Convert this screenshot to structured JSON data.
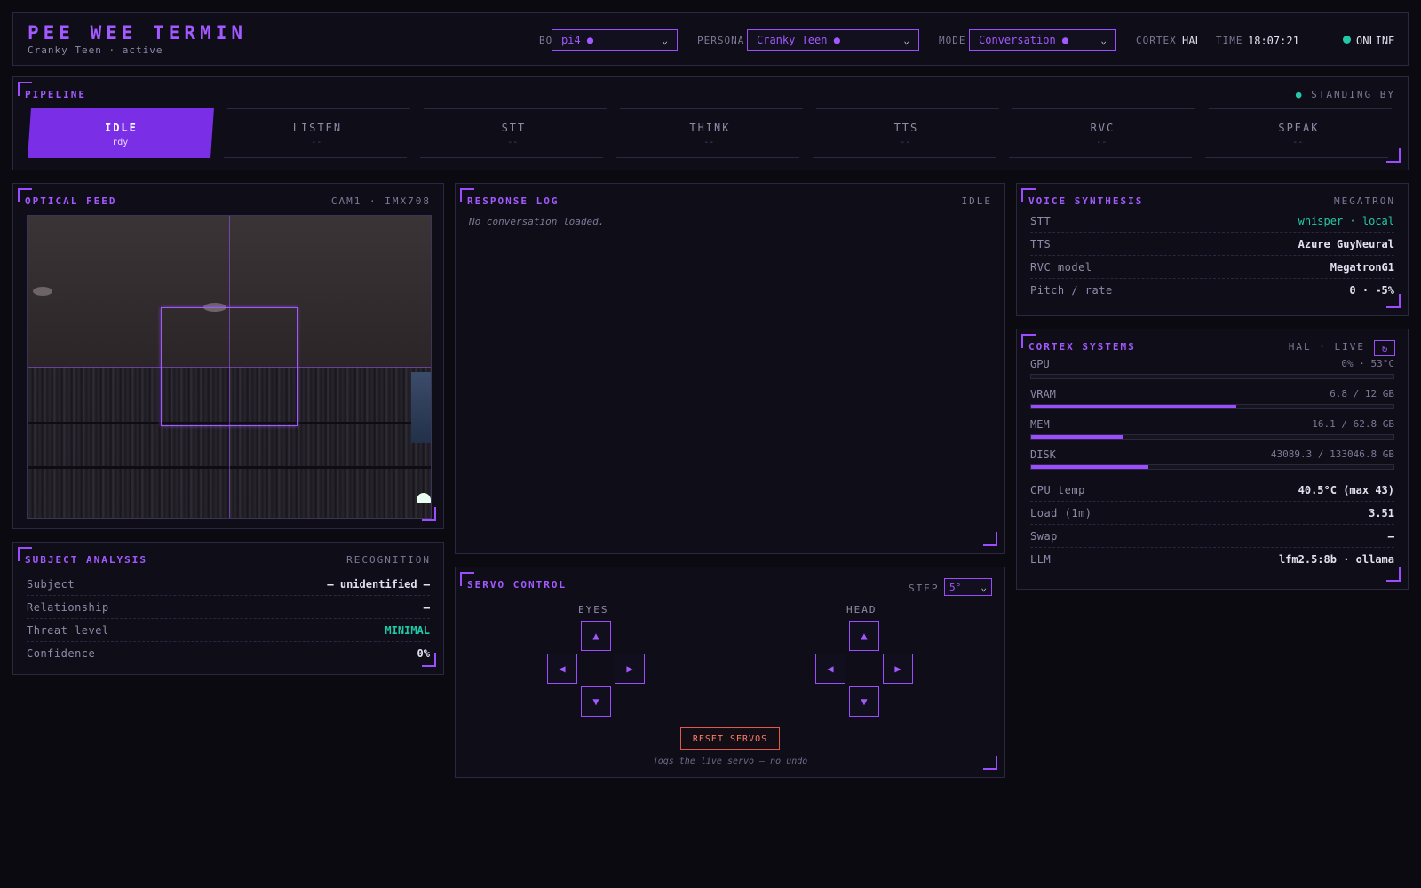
{
  "header": {
    "title": "PEE WEE TERMIN",
    "subtitle": "Cranky Teen · active",
    "bot_label": "BOT",
    "bot_value": "pi4 ●",
    "persona_label": "PERSONA",
    "persona_value": "Cranky Teen ●",
    "mode_label": "MODE",
    "mode_value": "Conversation ●",
    "cortex_label": "CORTEX",
    "cortex_value": "HAL",
    "time_label": "TIME",
    "time_value": "18:07:21",
    "status": "ONLINE",
    "status_color": "#22c8a8"
  },
  "pipeline": {
    "title": "PIPELINE",
    "status": "STANDING BY",
    "stages": [
      {
        "name": "IDLE",
        "value": "rdy",
        "active": true
      },
      {
        "name": "LISTEN",
        "value": "--"
      },
      {
        "name": "STT",
        "value": "--"
      },
      {
        "name": "THINK",
        "value": "--"
      },
      {
        "name": "TTS",
        "value": "--"
      },
      {
        "name": "RVC",
        "value": "--"
      },
      {
        "name": "SPEAK",
        "value": "--"
      }
    ]
  },
  "optical": {
    "title": "OPTICAL FEED",
    "meta": "CAM1 · IMX708"
  },
  "subject": {
    "title": "SUBJECT ANALYSIS",
    "meta": "RECOGNITION",
    "rows": [
      {
        "key": "Subject",
        "value": "– unidentified –"
      },
      {
        "key": "Relationship",
        "value": "–"
      },
      {
        "key": "Threat level",
        "value": "MINIMAL"
      },
      {
        "key": "Confidence",
        "value": "0%"
      }
    ]
  },
  "response": {
    "title": "RESPONSE LOG",
    "meta": "IDLE",
    "empty_text": "No conversation loaded."
  },
  "servo": {
    "title": "SERVO CONTROL",
    "step_label": "STEP",
    "step_value": "5°",
    "eyes_label": "EYES",
    "head_label": "HEAD",
    "up": "▲",
    "down": "▼",
    "left": "◀",
    "right": "▶",
    "reset_label": "RESET SERVOS",
    "note": "jogs the live servo — no undo"
  },
  "voice": {
    "title": "VOICE SYNTHESIS",
    "meta": "MEGATRON",
    "rows": [
      {
        "key": "STT",
        "value": "whisper · local"
      },
      {
        "key": "TTS",
        "value": "Azure GuyNeural"
      },
      {
        "key": "RVC model",
        "value": "MegatronG1"
      },
      {
        "key": "Pitch / rate",
        "value": "0 · -5%"
      }
    ]
  },
  "cortex": {
    "title": "CORTEX SYSTEMS",
    "meta": "HAL · LIVE",
    "refresh": "↻",
    "meters": [
      {
        "key": "GPU",
        "value": "0% · 53°C",
        "fraction": 0.0
      },
      {
        "key": "VRAM",
        "value": "6.8 / 12 GB",
        "fraction": 0.567
      },
      {
        "key": "MEM",
        "value": "16.1 / 62.8 GB",
        "fraction": 0.256
      },
      {
        "key": "DISK",
        "value": "43089.3 / 133046.8 GB",
        "fraction": 0.324
      }
    ],
    "rows": [
      {
        "key": "CPU temp",
        "value": "40.5°C (max 43)"
      },
      {
        "key": "Load (1m)",
        "value": "3.51"
      },
      {
        "key": "Swap",
        "value": "–"
      },
      {
        "key": "LLM",
        "value": "lfm2.5:8b · ollama"
      }
    ]
  },
  "colors": {
    "accent": "#a259ff",
    "accent_fill": "#7a2ee6",
    "ok": "#22c8a8",
    "danger": "#e05a4a"
  }
}
